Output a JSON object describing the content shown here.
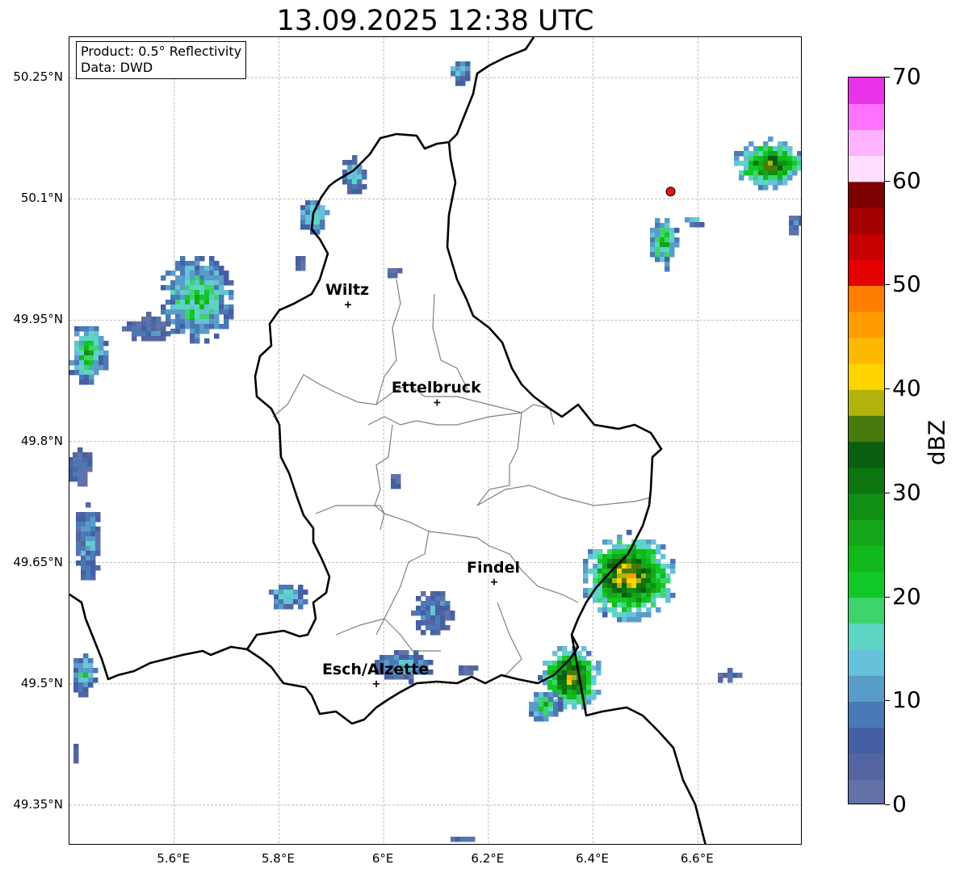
{
  "title": "13.09.2025 12:38 UTC",
  "info": {
    "product": "Product: 0.5° Reflectivity",
    "data": "Data: DWD"
  },
  "lat_ticks": [
    "50.25°N",
    "50.1°N",
    "49.95°N",
    "49.8°N",
    "49.65°N",
    "49.5°N",
    "49.35°N"
  ],
  "lon_ticks": [
    "5.6°E",
    "5.8°E",
    "6°E",
    "6.2°E",
    "6.4°E",
    "6.6°E"
  ],
  "cities": [
    {
      "name": "Wiltz",
      "lat": 49.969,
      "lon": 5.932
    },
    {
      "name": "Ettelbruck",
      "lat": 49.848,
      "lon": 6.102
    },
    {
      "name": "Findel",
      "lat": 49.626,
      "lon": 6.211
    },
    {
      "name": "Esch/Alzette",
      "lat": 49.5,
      "lon": 5.986
    }
  ],
  "colorbar": {
    "label": "dBZ",
    "ticks": [
      "0",
      "10",
      "20",
      "30",
      "40",
      "50",
      "60",
      "70"
    ],
    "range": [
      0,
      70
    ],
    "colors": [
      "#6272a8",
      "#5465a1",
      "#4460a3",
      "#4a7ab5",
      "#5a9cc9",
      "#66c1da",
      "#5ed4c4",
      "#3dd46d",
      "#12c829",
      "#12b91a",
      "#14a518",
      "#108f14",
      "#0c7510",
      "#0a5e0f",
      "#487a0e",
      "#b1b30c",
      "#ffd500",
      "#ffb800",
      "#ff9d00",
      "#ff7e00",
      "#e30000",
      "#c40000",
      "#a40000",
      "#7d0000",
      "#ffdeff",
      "#ffb2ff",
      "#ff72ff",
      "#e833e8"
    ]
  },
  "radar_site": {
    "lat": 50.109,
    "lon": 6.548,
    "color": "#e31515"
  }
}
